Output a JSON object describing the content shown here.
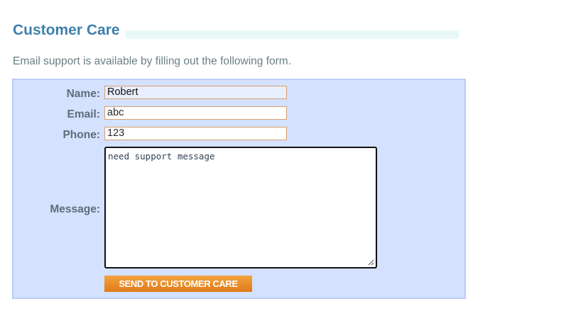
{
  "header": {
    "title": "Customer Care",
    "intro": "Email support is available by filling out the following form."
  },
  "form": {
    "name": {
      "label": "Name:",
      "value": "Robert"
    },
    "email": {
      "label": "Email:",
      "value": "abc"
    },
    "phone": {
      "label": "Phone:",
      "value": "123"
    },
    "message": {
      "label": "Message:",
      "value": "need support message"
    },
    "submit_label": "SEND TO CUSTOMER CARE"
  },
  "colors": {
    "title": "#3f7fab",
    "form_background": "#d4e1ff",
    "button": "#e88a22"
  },
  "icons": {
    "resize": "resize-grip-icon"
  }
}
